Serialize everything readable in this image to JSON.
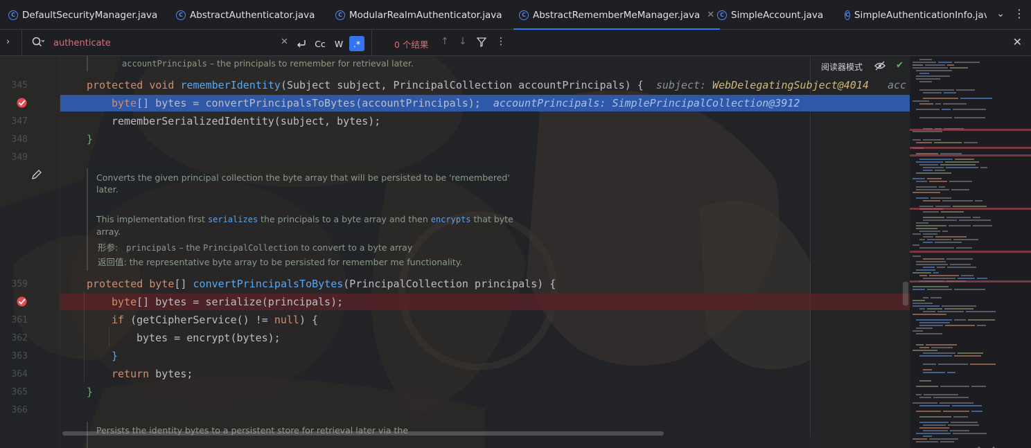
{
  "tabs": [
    {
      "name": "DefaultSecurityManager.java",
      "active": false
    },
    {
      "name": "AbstractAuthenticator.java",
      "active": false
    },
    {
      "name": "ModularRealmAuthenticator.java",
      "active": false
    },
    {
      "name": "AbstractRememberMeManager.java",
      "active": true
    },
    {
      "name": "SimpleAccount.java",
      "active": false
    },
    {
      "name": "SimpleAuthenticationInfo.java",
      "active": false
    }
  ],
  "search": {
    "query": "authenticate",
    "match_case": "Cc",
    "words": "W",
    "regex": ".*",
    "results": "0 个结果"
  },
  "editor": {
    "reader_mode": "阅读器模式",
    "doc_top": {
      "param": "accountPrincipals",
      "text": " – the principals to remember for retrieval later."
    },
    "lines": {
      "l345": {
        "num": "345",
        "kw1": "protected",
        "kw2": "void",
        "fn": "rememberIdentity",
        "rest": "(Subject subject, PrincipalCollection accountPrincipals) {",
        "hint_label": "subject:",
        "hint_value": "WebDelegatingSubject@4014",
        "hint_more": "acc"
      },
      "l346": {
        "kw1": "byte",
        "rest": "[] bytes = convertPrincipalsToBytes(accountPrincipals);",
        "hint_label": "accountPrincipals:",
        "hint_value": "SimplePrincipalCollection@3912"
      },
      "l347": {
        "num": "347",
        "text": "rememberSerializedIdentity(subject, bytes);"
      },
      "l348": {
        "num": "348",
        "text": "}"
      },
      "l349": {
        "num": "349"
      },
      "l359": {
        "num": "359",
        "kw1": "protected",
        "kw2": "byte",
        "mid": "[] ",
        "fn": "convertPrincipalsToBytes",
        "rest": "(PrincipalCollection principals) {"
      },
      "l360": {
        "kw1": "byte",
        "rest": "[] bytes = serialize(principals);"
      },
      "l361": {
        "num": "361",
        "kw1": "if",
        "rest": " (getCipherService() != ",
        "kw2": "null",
        "tail": ") {"
      },
      "l362": {
        "num": "362",
        "text": "bytes = encrypt(bytes);"
      },
      "l363": {
        "num": "363",
        "text": "}"
      },
      "l364": {
        "num": "364",
        "kw1": "return",
        "rest": " bytes;"
      },
      "l365": {
        "num": "365",
        "text": "}"
      },
      "l366": {
        "num": "366"
      }
    },
    "doc_mid": {
      "p1a": "Converts the given principal collection the byte array that will be persisted to be 'remembered'",
      "p1b": "later.",
      "p2a": "This implementation first ",
      "p2_link1": "serializes",
      "p2b": " the principals to a byte array and then ",
      "p2_link2": "encrypts",
      "p2c": " that byte",
      "p2d": "array.",
      "param_label": "形参:",
      "param_name": "principals",
      "param_dash": " – the ",
      "param_type": "PrincipalCollection",
      "param_rest": " to convert to a byte array",
      "return_label": "返回值:",
      "return_text": "the representative byte array to be persisted for remember me functionality."
    },
    "doc_bottom": "Persists the identity bytes to a persistent store for retrieval later via the"
  },
  "colors": {
    "accent": "#3574f0",
    "keyword": "#cf8e6d",
    "function": "#56a8f5",
    "execution_line": "#2f58a8",
    "breakpoint_line": "#5a2326",
    "search_error": "#e06c75"
  }
}
